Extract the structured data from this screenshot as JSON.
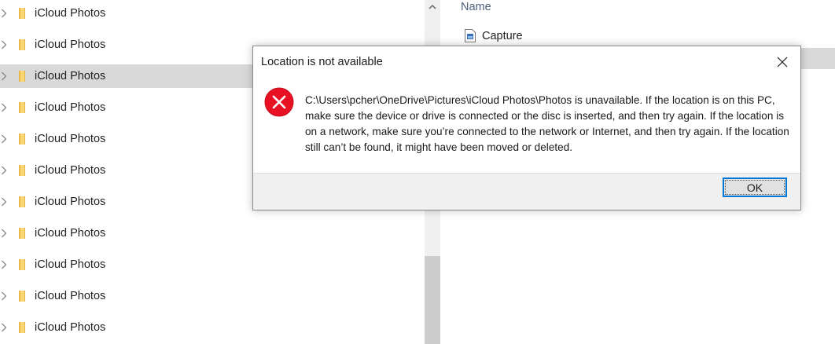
{
  "nav": {
    "items": [
      {
        "label": "iCloud Photos"
      },
      {
        "label": "iCloud Photos"
      },
      {
        "label": "iCloud Photos",
        "selected": true
      },
      {
        "label": "iCloud Photos"
      },
      {
        "label": "iCloud Photos"
      },
      {
        "label": "iCloud Photos"
      },
      {
        "label": "iCloud Photos"
      },
      {
        "label": "iCloud Photos"
      },
      {
        "label": "iCloud Photos"
      },
      {
        "label": "iCloud Photos"
      },
      {
        "label": "iCloud Photos"
      }
    ]
  },
  "content": {
    "column_header": "Name",
    "files": [
      {
        "label": "Capture",
        "icon": "image-file-icon"
      }
    ]
  },
  "dialog": {
    "title": "Location is not available",
    "close_glyph": "✕",
    "message": "C:\\Users\\pcher\\OneDrive\\Pictures\\iCloud Photos\\Photos is unavailable. If the location is on this PC, make sure the device or drive is connected or the disc is inserted, and then try again. If the location is on a network, make sure you’re connected to the network or Internet, and then try again. If the location still can’t be found, it might have been moved or deleted.",
    "ok_label": "OK",
    "icon": "error-icon"
  },
  "colors": {
    "selection": "#d9d9d9",
    "error_red": "#e81123",
    "accent": "#0078d7",
    "folder_yellow": "#f8d775"
  }
}
